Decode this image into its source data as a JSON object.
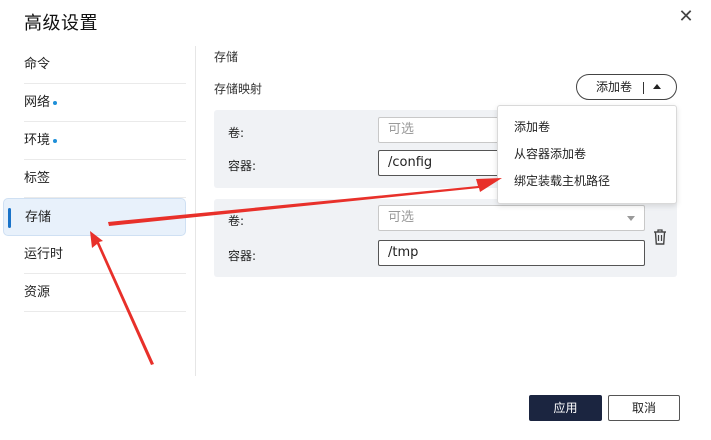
{
  "dialog": {
    "title": "高级设置",
    "close_symbol": "✕"
  },
  "sidebar": {
    "items": [
      {
        "label": "命令",
        "dot": false
      },
      {
        "label": "网络",
        "dot": true
      },
      {
        "label": "环境",
        "dot": true
      },
      {
        "label": "标签",
        "dot": false
      },
      {
        "label": "存储",
        "dot": false,
        "active": true
      },
      {
        "label": "运行时",
        "dot": false
      },
      {
        "label": "资源",
        "dot": false
      }
    ]
  },
  "main": {
    "section_title": "存储",
    "mapping_label": "存储映射",
    "add_volume_label": "添加卷",
    "mappings": [
      {
        "volume_label": "卷:",
        "volume_placeholder": "可选",
        "container_label": "容器:",
        "container_value": "/config"
      },
      {
        "volume_label": "卷:",
        "volume_placeholder": "可选",
        "container_label": "容器:",
        "container_value": "/tmp"
      }
    ]
  },
  "dropdown_menu": {
    "items": [
      "添加卷",
      "从容器添加卷",
      "绑定装载主机路径"
    ]
  },
  "footer": {
    "apply_label": "应用",
    "cancel_label": "取消"
  },
  "colors": {
    "accent": "#1a73c9",
    "primary_button": "#1b2540",
    "annotation_arrow": "#e8302a"
  }
}
